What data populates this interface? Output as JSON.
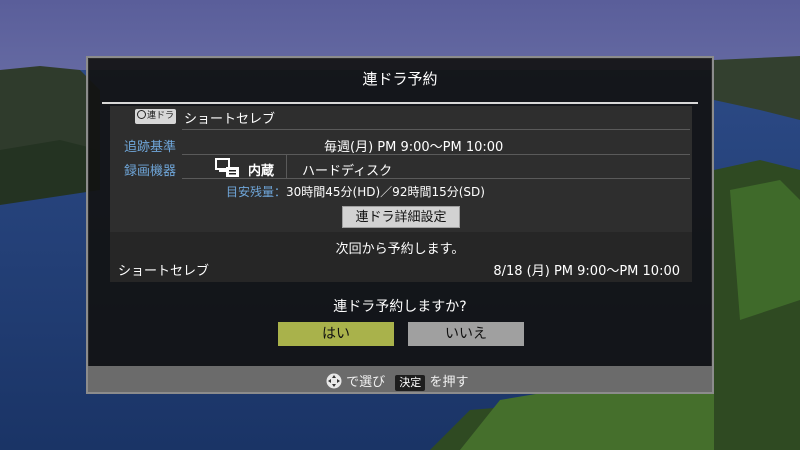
{
  "dialog": {
    "title": "連ドラ予約",
    "badge_label": "連ドラ",
    "program_name": "ショートセレブ",
    "tracking_label": "追跡基準",
    "tracking_value": "毎週(月) PM 9:00～PM 10:00",
    "device_label": "録画機器",
    "device_storage": "内蔵",
    "device_type": "ハードディスク",
    "remaining_label": "目安残量：",
    "remaining_value": "30時間45分(HD)／92時間15分(SD)",
    "detail_button": "連ドラ詳細設定",
    "next_notice": "次回から予約します。",
    "next_program": "ショートセレブ",
    "next_datetime": "8/18 (月) PM 9:00～PM 10:00",
    "question": "連ドラ予約しますか?",
    "yes_button": "はい",
    "no_button": "いいえ"
  },
  "footer": {
    "select_text": "で選び",
    "kettei_key": "決定",
    "press_text": "を押す"
  },
  "colors": {
    "label_blue": "#6fa6d9",
    "yes_button": "#a9b24b",
    "no_button": "#a0a0a0",
    "footer_bar": "#6b6b6b"
  }
}
